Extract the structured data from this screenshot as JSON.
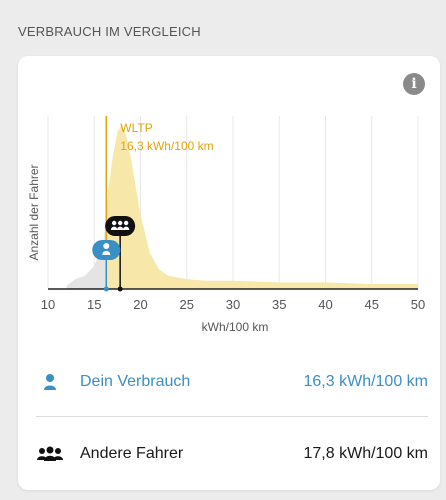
{
  "section_title": "VERBRAUCH IM VERGLEICH",
  "info_icon_glyph": "i",
  "chart_data": {
    "type": "area",
    "xlabel": "kWh/100 km",
    "ylabel": "Anzahl der Fahrer",
    "xlim": [
      10,
      50
    ],
    "x_ticks": [
      "10",
      "15",
      "20",
      "25",
      "30",
      "35",
      "40",
      "45",
      "50"
    ],
    "grid": true,
    "series": [
      {
        "x": [
          12,
          13,
          14,
          15,
          16,
          16.5,
          17,
          17.5,
          18,
          18.5,
          19,
          20,
          21,
          22,
          23,
          24,
          25,
          27,
          30,
          35,
          40,
          45,
          50
        ],
        "values": [
          2,
          6,
          8,
          14,
          28,
          60,
          80,
          95,
          100,
          92,
          78,
          45,
          22,
          12,
          8,
          7,
          6,
          5,
          5,
          4,
          4,
          3,
          3
        ],
        "color": "#f7e7a8"
      }
    ],
    "wltp": {
      "label": "WLTP",
      "value_label": "16,3 kWh/100 km",
      "x": 16.3,
      "color": "#e0a40a"
    },
    "markers": [
      {
        "id": "mine",
        "x": 16.3,
        "color": "#3a8fc4"
      },
      {
        "id": "others",
        "x": 17.8,
        "color": "#111111"
      }
    ]
  },
  "legend": {
    "mine": {
      "label": "Dein Verbrauch",
      "value": "16,3 kWh/100 km",
      "icon": "person-icon"
    },
    "others": {
      "label": "Andere Fahrer",
      "value": "17,8 kWh/100 km",
      "icon": "group-icon"
    }
  }
}
